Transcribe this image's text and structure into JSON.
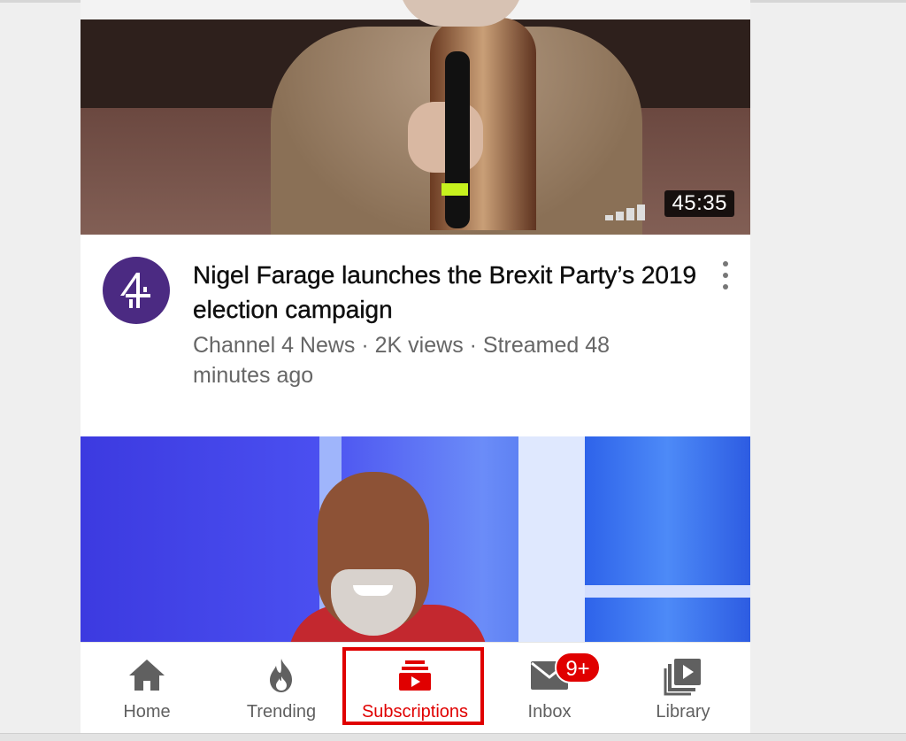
{
  "video1": {
    "duration": "45:35",
    "title": "Nigel Farage launches the Brexit Party’s 2019 election campaign",
    "meta": "Channel 4 News · 2K views · Streamed 48 minutes ago",
    "channel_avatar_icon": "channel4-logo-icon"
  },
  "video2": {},
  "bottom_nav": {
    "items": [
      {
        "label": "Home",
        "icon": "home-icon"
      },
      {
        "label": "Trending",
        "icon": "flame-icon"
      },
      {
        "label": "Subscriptions",
        "icon": "subscriptions-icon",
        "active": true
      },
      {
        "label": "Inbox",
        "icon": "inbox-mail-icon"
      },
      {
        "label": "Library",
        "icon": "library-icon"
      }
    ],
    "inbox_badge": "9+"
  },
  "colors": {
    "accent": "#e00000",
    "avatar_bg": "#4b2a82",
    "inactive": "#606060"
  }
}
